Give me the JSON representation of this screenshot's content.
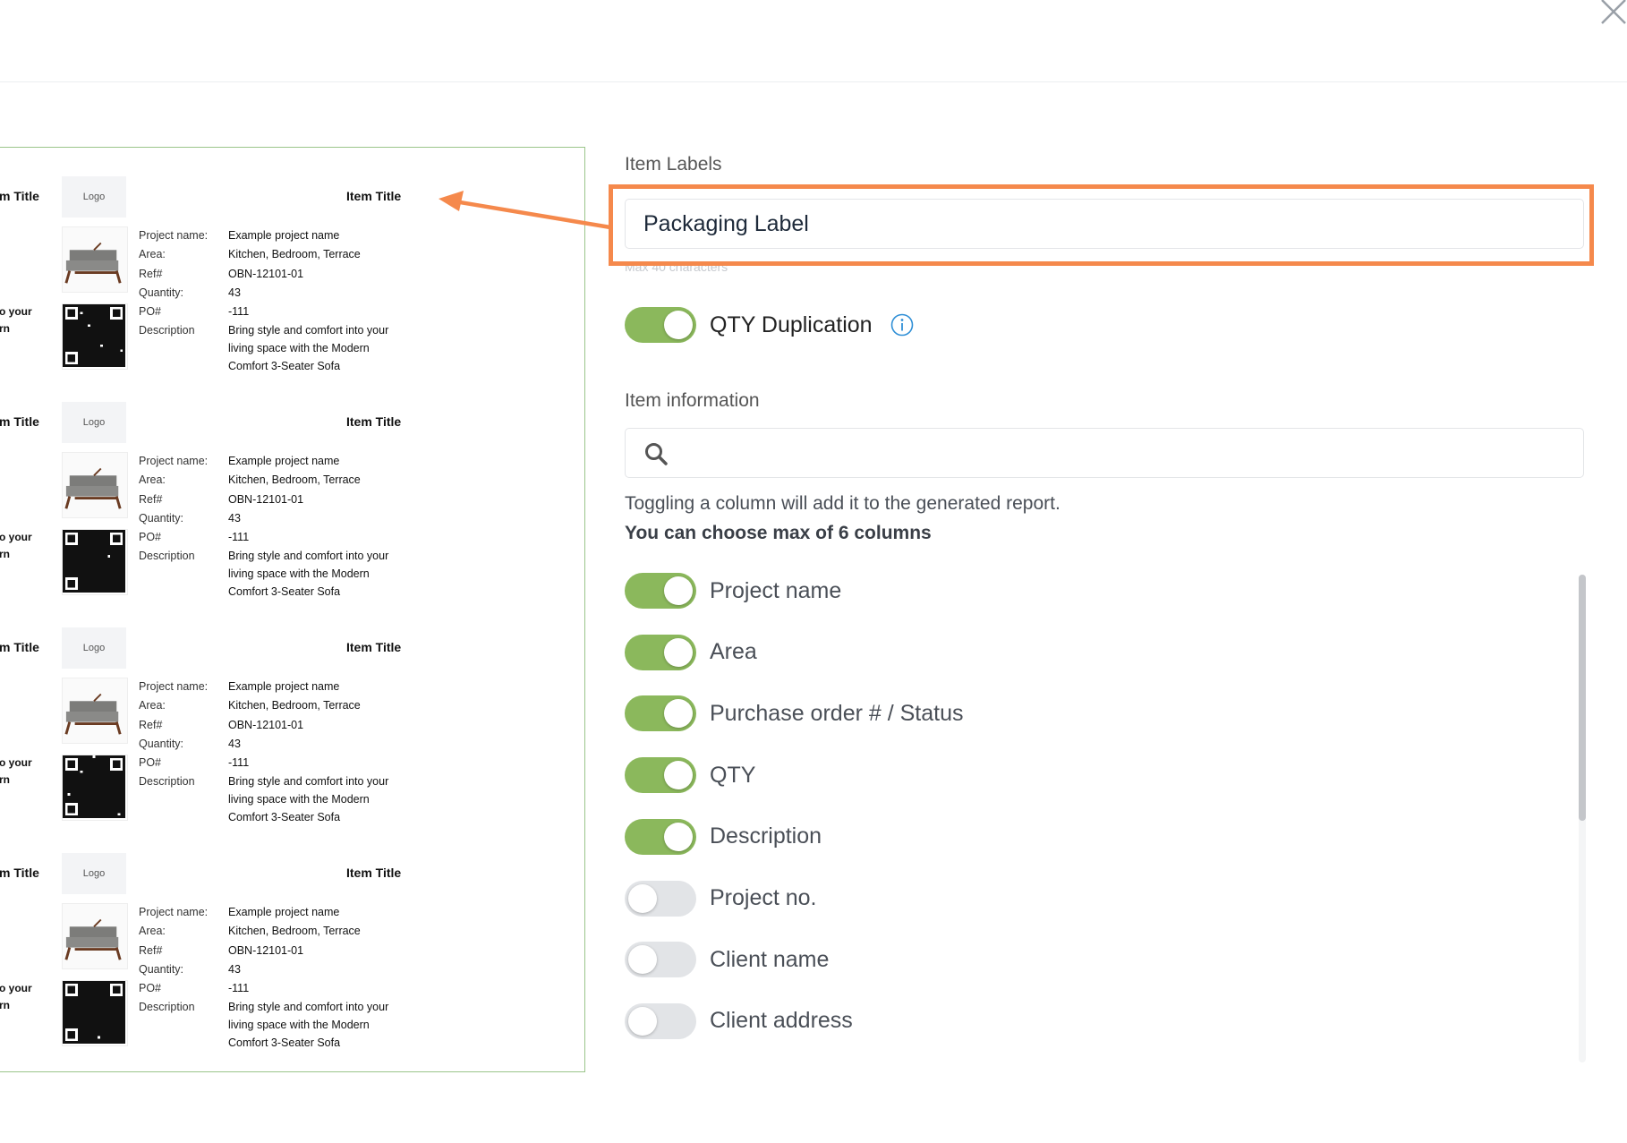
{
  "dialog": {
    "close_icon": "close-icon"
  },
  "preview": {
    "labels": [
      {
        "logo": "Logo",
        "item_title": "Item Title",
        "cut_title": "m Title",
        "cut_text_1": "o your",
        "cut_text_2": "rn",
        "fields": [
          "Project name:",
          "Area:",
          "Ref#",
          "Quantity:",
          "PO#",
          "Description"
        ],
        "values": [
          "Example project name",
          "Kitchen, Bedroom, Terrace",
          "OBN-12101-01",
          "43",
          "-111"
        ],
        "description": [
          "Bring style and comfort into your",
          "living space with the Modern",
          "Comfort 3-Seater Sofa"
        ]
      },
      {
        "logo": "Logo",
        "item_title": "Item Title",
        "cut_title": "m Title",
        "cut_text_1": "o your",
        "cut_text_2": "rn",
        "fields": [
          "Project name:",
          "Area:",
          "Ref#",
          "Quantity:",
          "PO#",
          "Description"
        ],
        "values": [
          "Example project name",
          "Kitchen, Bedroom, Terrace",
          "OBN-12101-01",
          "43",
          "-111"
        ],
        "description": [
          "Bring style and comfort into your",
          "living space with the Modern",
          "Comfort 3-Seater Sofa"
        ]
      },
      {
        "logo": "Logo",
        "item_title": "Item Title",
        "cut_title": "m Title",
        "cut_text_1": "o your",
        "cut_text_2": "rn",
        "fields": [
          "Project name:",
          "Area:",
          "Ref#",
          "Quantity:",
          "PO#",
          "Description"
        ],
        "values": [
          "Example project name",
          "Kitchen, Bedroom, Terrace",
          "OBN-12101-01",
          "43",
          "-111"
        ],
        "description": [
          "Bring style and comfort into your",
          "living space with the Modern",
          "Comfort 3-Seater Sofa"
        ]
      },
      {
        "logo": "Logo",
        "item_title": "Item Title",
        "cut_title": "m Title",
        "cut_text_1": "o your",
        "cut_text_2": "rn",
        "fields": [
          "Project name:",
          "Area:",
          "Ref#",
          "Quantity:",
          "PO#",
          "Description"
        ],
        "values": [
          "Example project name",
          "Kitchen, Bedroom, Terrace",
          "OBN-12101-01",
          "43",
          "-111"
        ],
        "description": [
          "Bring style and comfort into your",
          "living space with the Modern",
          "Comfort 3-Seater Sofa"
        ]
      }
    ]
  },
  "settings": {
    "item_labels_title": "Item Labels",
    "item_labels_value": "Packaging Label",
    "item_labels_hint": "Max 40 characters",
    "qty_duplication_label": "QTY Duplication",
    "qty_duplication_on": true,
    "item_information_title": "Item information",
    "search_placeholder": "",
    "toggle_info": "Toggling a column will add it to the generated report.",
    "max_columns": "You can choose max of 6 columns",
    "columns": [
      {
        "label": "Project name",
        "on": true
      },
      {
        "label": "Area",
        "on": true
      },
      {
        "label": "Purchase order # / Status",
        "on": true
      },
      {
        "label": "QTY",
        "on": true
      },
      {
        "label": "Description",
        "on": true
      },
      {
        "label": "Project no.",
        "on": false
      },
      {
        "label": "Client name",
        "on": false
      },
      {
        "label": "Client address",
        "on": false
      }
    ]
  },
  "colors": {
    "accent_green": "#8bb85c",
    "annotation_orange": "#f5894c",
    "info_blue": "#2f8fd6"
  }
}
